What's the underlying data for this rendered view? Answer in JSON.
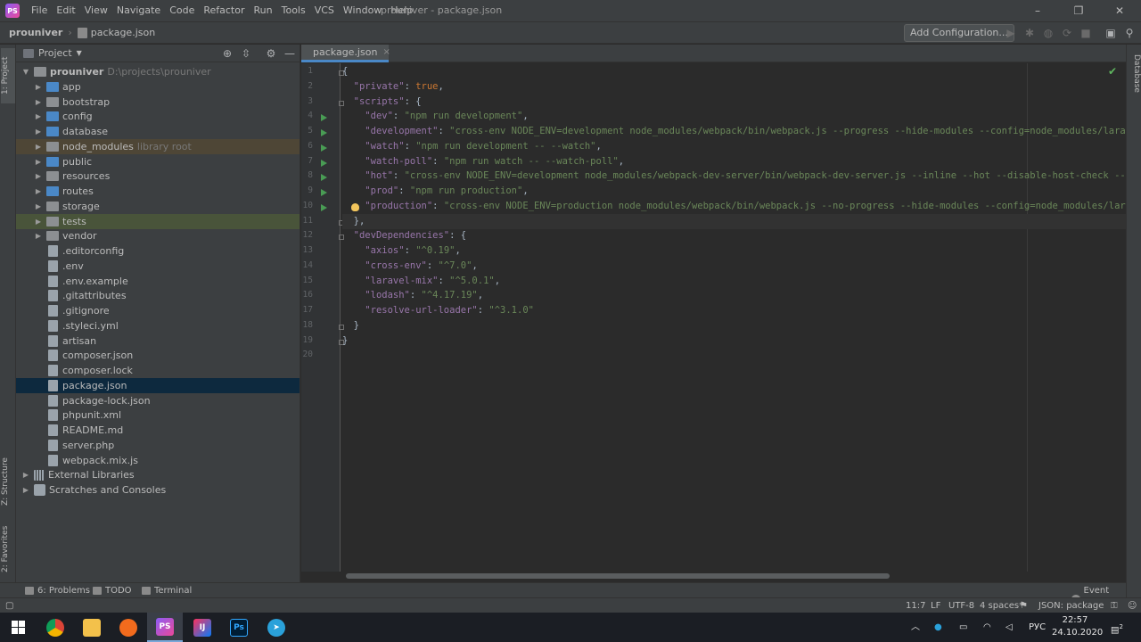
{
  "window": {
    "title": "prouniver - package.json",
    "app_logo": "PS",
    "controls": [
      "–",
      "❐",
      "✕"
    ]
  },
  "menu": [
    "File",
    "Edit",
    "View",
    "Navigate",
    "Code",
    "Refactor",
    "Run",
    "Tools",
    "VCS",
    "Window",
    "Help"
  ],
  "navbar": {
    "project": "prouniver",
    "separator": "›",
    "file": "package.json",
    "add_config": "Add Configuration..."
  },
  "left_tabs": {
    "project": "1: Project",
    "structure": "Z: Structure",
    "favorites": "2: Favorites"
  },
  "right_tabs": {
    "database": "Database"
  },
  "project_panel": {
    "label": "Project",
    "root": {
      "name": "prouniver",
      "path": "D:\\projects\\prouniver"
    },
    "items": [
      {
        "name": "app",
        "kind": "folder"
      },
      {
        "name": "bootstrap",
        "kind": "folder"
      },
      {
        "name": "config",
        "kind": "folder"
      },
      {
        "name": "database",
        "kind": "folder"
      },
      {
        "name": "node_modules",
        "kind": "folder",
        "extra": "library root"
      },
      {
        "name": "public",
        "kind": "folder"
      },
      {
        "name": "resources",
        "kind": "folder"
      },
      {
        "name": "routes",
        "kind": "folder"
      },
      {
        "name": "storage",
        "kind": "folder"
      },
      {
        "name": "tests",
        "kind": "folder"
      },
      {
        "name": "vendor",
        "kind": "folder"
      },
      {
        "name": ".editorconfig",
        "kind": "file"
      },
      {
        "name": ".env",
        "kind": "file"
      },
      {
        "name": ".env.example",
        "kind": "file"
      },
      {
        "name": ".gitattributes",
        "kind": "file"
      },
      {
        "name": ".gitignore",
        "kind": "file"
      },
      {
        "name": ".styleci.yml",
        "kind": "file"
      },
      {
        "name": "artisan",
        "kind": "file"
      },
      {
        "name": "composer.json",
        "kind": "file"
      },
      {
        "name": "composer.lock",
        "kind": "file"
      },
      {
        "name": "package.json",
        "kind": "file"
      },
      {
        "name": "package-lock.json",
        "kind": "file"
      },
      {
        "name": "phpunit.xml",
        "kind": "file"
      },
      {
        "name": "README.md",
        "kind": "file"
      },
      {
        "name": "server.php",
        "kind": "file"
      },
      {
        "name": "webpack.mix.js",
        "kind": "file"
      }
    ],
    "external_libraries": "External Libraries",
    "scratches": "Scratches and Consoles"
  },
  "editor": {
    "tab": "package.json",
    "close": "×",
    "lines": [
      "{",
      "  \"private\": true,",
      "  \"scripts\": {",
      "    \"dev\": \"npm run development\",",
      "    \"development\": \"cross-env NODE_ENV=development node_modules/webpack/bin/webpack.js --progress --hide-modules --config=node_modules/laravel",
      "    \"watch\": \"npm run development -- --watch\",",
      "    \"watch-poll\": \"npm run watch -- --watch-poll\",",
      "    \"hot\": \"cross-env NODE_ENV=development node_modules/webpack-dev-server/bin/webpack-dev-server.js --inline --hot --disable-host-check --con",
      "    \"prod\": \"npm run production\",",
      "    \"production\": \"cross-env NODE_ENV=production node_modules/webpack/bin/webpack.js --no-progress --hide-modules --config=node_modules/larave",
      "  },",
      "  \"devDependencies\": {",
      "    \"axios\": \"^0.19\",",
      "    \"cross-env\": \"^7.0\",",
      "    \"laravel-mix\": \"^5.0.1\",",
      "    \"lodash\": \"^4.17.19\",",
      "    \"resolve-url-loader\": \"^3.1.0\"",
      "  }",
      "}",
      ""
    ]
  },
  "bottom_tools": {
    "problems": "6: Problems",
    "todo": "TODO",
    "terminal": "Terminal",
    "event_log": "Event Log"
  },
  "status": {
    "position": "11:7",
    "line_sep": "LF",
    "encoding": "UTF-8",
    "indent": "4 spaces*",
    "schema": "JSON: package"
  },
  "taskbar": {
    "tray_lang": "РУС",
    "time": "22:57",
    "date": "24.10.2020",
    "notifications": "2"
  }
}
